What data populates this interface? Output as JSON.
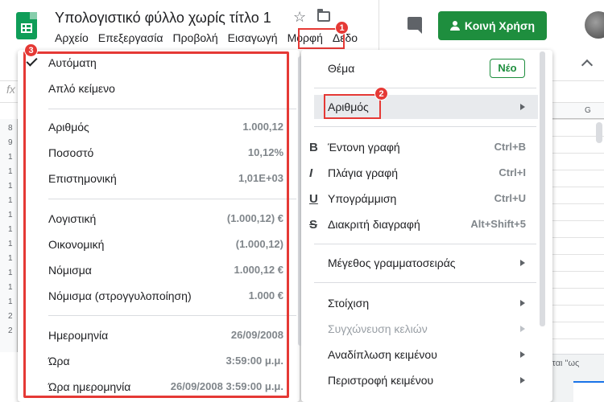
{
  "app": {
    "title": "Υπολογιστικό φύλλο χωρίς τίτλο 1",
    "share_label": "Κοινή Χρήση",
    "formula_fx": "fx",
    "bottom_text": "γται \"ως"
  },
  "menubar": [
    "Αρχείο",
    "Επεξεργασία",
    "Προβολή",
    "Εισαγωγή",
    "Μορφή",
    "Δεδο"
  ],
  "badges": [
    "1",
    "2",
    "3"
  ],
  "column_header": "G",
  "row_numbers": [
    "8",
    "9",
    "1",
    "1",
    "1",
    "1",
    "1",
    "1",
    "1",
    "1",
    "1",
    "1",
    "1",
    "2",
    "2"
  ],
  "number_formats": [
    {
      "label": "Αυτόματη",
      "value": "",
      "checked": true
    },
    {
      "label": "Απλό κείμενο",
      "value": ""
    },
    {
      "label": "Αριθμός",
      "value": "1.000,12"
    },
    {
      "label": "Ποσοστό",
      "value": "10,12%"
    },
    {
      "label": "Επιστημονική",
      "value": "1,01E+03"
    },
    {
      "label": "Λογιστική",
      "value": "(1.000,12) €"
    },
    {
      "label": "Οικονομική",
      "value": "(1.000,12)"
    },
    {
      "label": "Νόμισμα",
      "value": "1.000,12 €"
    },
    {
      "label": "Νόμισμα (στρογγυλοποίηση)",
      "value": "1.000 €"
    },
    {
      "label": "Ημερομηνία",
      "value": "26/09/2008"
    },
    {
      "label": "Ώρα",
      "value": "3:59:00 μ.μ."
    },
    {
      "label": "Ώρα ημερομηνία",
      "value": "26/09/2008 3:59:00 μ.μ."
    }
  ],
  "format_menu": {
    "theme": {
      "label": "Θέμα",
      "badge": "Νέο"
    },
    "number": {
      "label": "Αριθμός"
    },
    "bold": {
      "icon": "B",
      "label": "Έντονη γραφή",
      "shortcut": "Ctrl+B"
    },
    "italic": {
      "icon": "I",
      "label": "Πλάγια γραφή",
      "shortcut": "Ctrl+I"
    },
    "underline": {
      "icon": "U",
      "label": "Υπογράμμιση",
      "shortcut": "Ctrl+U"
    },
    "strikethrough": {
      "icon": "S",
      "label": "Διακριτή διαγραφή",
      "shortcut": "Alt+Shift+5"
    },
    "font_size": {
      "label": "Μέγεθος γραμματοσειράς"
    },
    "align": {
      "label": "Στοίχιση"
    },
    "merge": {
      "label": "Συγχώνευση κελιών"
    },
    "wrap": {
      "label": "Αναδίπλωση κειμένου"
    },
    "rotate": {
      "label": "Περιστροφή κειμένου"
    }
  },
  "icons": [
    "sheets-logo-icon",
    "star-icon",
    "folder-icon",
    "comment-icon",
    "person-icon",
    "check-icon",
    "chevron-up-icon",
    "submenu-arrow-icon"
  ],
  "colors": {
    "accent_green": "#1e8e3e",
    "annotation_red": "#e53935",
    "sheets_green": "#0f9d58"
  }
}
